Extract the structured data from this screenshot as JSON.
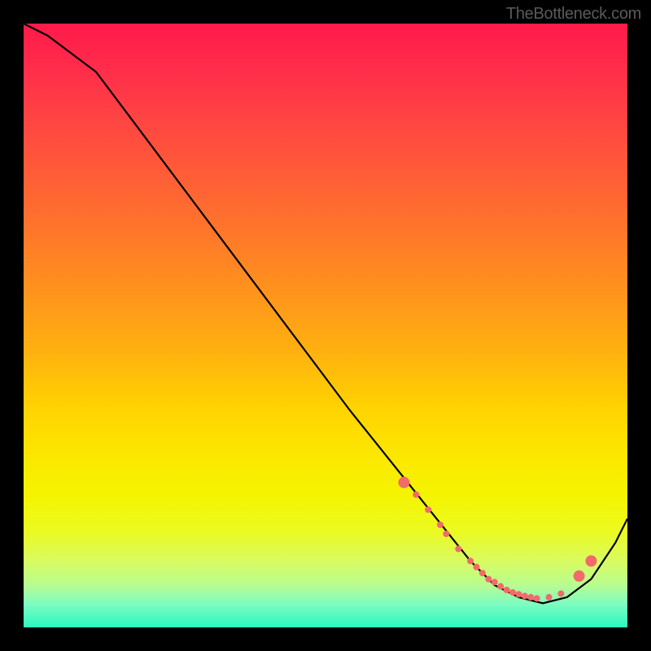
{
  "attribution": "TheBottleneck.com",
  "chart_data": {
    "type": "line",
    "title": "",
    "xlabel": "",
    "ylabel": "",
    "xlim": [
      0,
      100
    ],
    "ylim": [
      0,
      100
    ],
    "series": [
      {
        "name": "curve",
        "x": [
          0,
          4,
          8,
          12,
          18,
          24,
          30,
          36,
          42,
          48,
          54,
          58,
          62,
          66,
          70,
          74,
          78,
          82,
          86,
          90,
          94,
          98,
          100
        ],
        "y": [
          100,
          98,
          95,
          92,
          84,
          76,
          68,
          60,
          52,
          44,
          36,
          31,
          26,
          21,
          16,
          11,
          7,
          5,
          4,
          5,
          8,
          14,
          18
        ]
      }
    ],
    "markers": {
      "name": "dots",
      "x": [
        63,
        65,
        67,
        69,
        70,
        72,
        74,
        75,
        76,
        77,
        78,
        79,
        80,
        81,
        82,
        83,
        84,
        85,
        87,
        89,
        92,
        94
      ],
      "y": [
        24,
        22,
        19.5,
        17,
        15.5,
        13,
        11,
        10,
        9,
        8,
        7.5,
        6.8,
        6.2,
        5.8,
        5.5,
        5.2,
        5.0,
        4.8,
        5.0,
        5.6,
        8.5,
        11.0
      ],
      "color": "#f26a6a",
      "radius_small": 4,
      "radius_large": 7
    }
  }
}
